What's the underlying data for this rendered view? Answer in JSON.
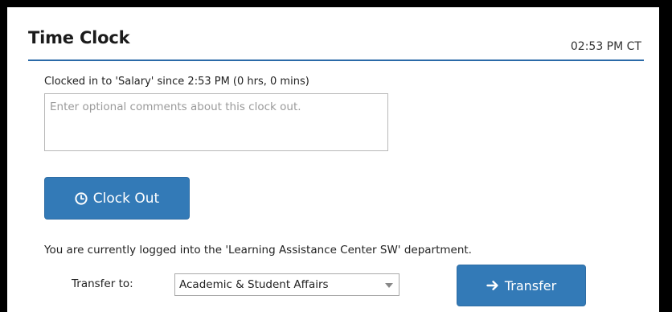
{
  "panel": {
    "title": "Time Clock",
    "time": "02:53 PM CT"
  },
  "clock": {
    "status": "Clocked in to 'Salary' since 2:53 PM (0 hrs, 0 mins)",
    "comments_value": "",
    "comments_placeholder": "Enter optional comments about this clock out.",
    "clock_out_label": "Clock Out",
    "clock_out_icon": "clock-icon"
  },
  "department": {
    "message": "You are currently logged into the 'Learning Assistance Center SW' department.",
    "transfer_label": "Transfer to:",
    "selected": "Academic & Student Affairs",
    "transfer_button_label": "Transfer",
    "transfer_icon": "arrow-right-icon"
  },
  "colors": {
    "primary": "#337ab7",
    "header_rule": "#2a6aa8"
  }
}
